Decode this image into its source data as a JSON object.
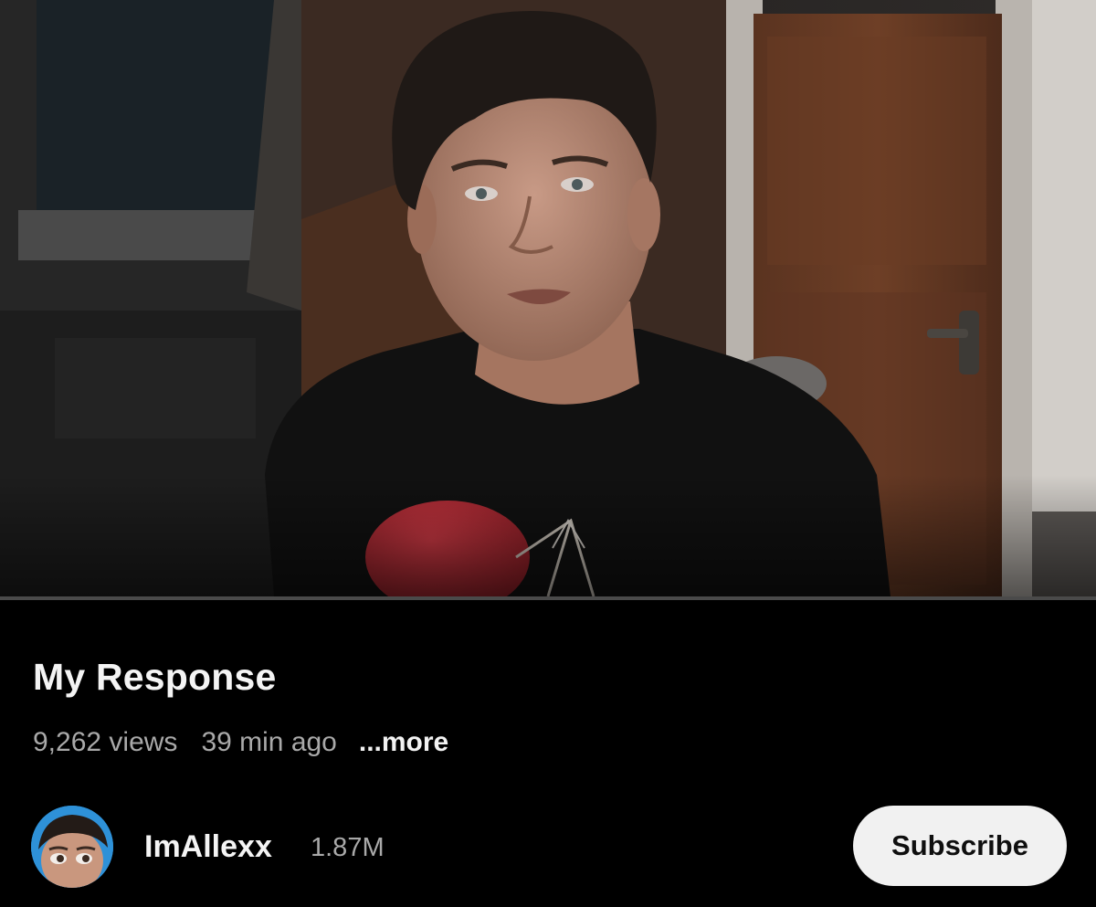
{
  "video": {
    "title": "My Response",
    "views": "9,262 views",
    "age": "39 min ago",
    "more_label": "...more",
    "progress_fraction": 0.0
  },
  "channel": {
    "name": "ImAllexx",
    "subscribers": "1.87M",
    "subscribe_label": "Subscribe"
  },
  "colors": {
    "background": "#000000",
    "subscribe_bg": "#f1f1f1",
    "secondary_text": "#a9a9a9"
  }
}
